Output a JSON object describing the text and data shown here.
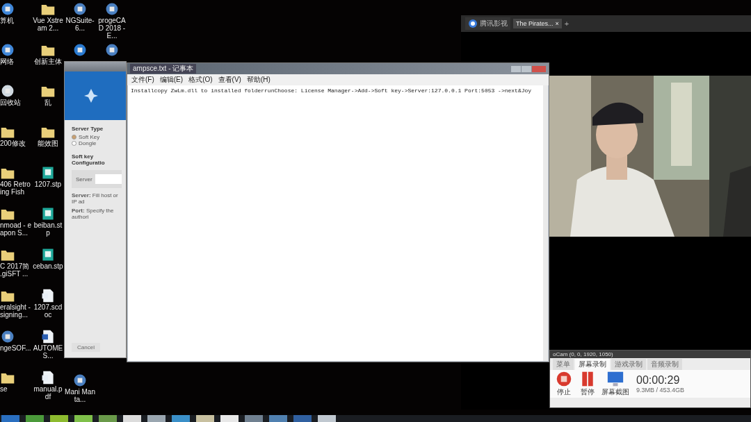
{
  "desktop_columns": [
    [
      {
        "label": "算机",
        "kind": "computer"
      },
      {
        "label": "网络",
        "kind": "network"
      },
      {
        "label": "回收站",
        "kind": "bin"
      },
      {
        "label": "200修改",
        "kind": "folder"
      },
      {
        "label": "406 Retro ing Fish",
        "kind": "folder"
      },
      {
        "label": "nmoad - eapon S...",
        "kind": "folder"
      },
      {
        "label": "C 2017简 .giSFT ...",
        "kind": "folder"
      },
      {
        "label": "eralsight - signing...",
        "kind": "folder"
      },
      {
        "label": "ngeSOF...",
        "kind": "app"
      },
      {
        "label": "se",
        "kind": "folder"
      }
    ],
    [
      {
        "label": "Vue Xstream 2...",
        "kind": "folder"
      },
      {
        "label": "创新主体",
        "kind": "folder"
      },
      {
        "label": "乱",
        "kind": "folder"
      },
      {
        "label": "能效图",
        "kind": "folder"
      },
      {
        "label": "1207.stp",
        "kind": "model"
      },
      {
        "label": "beiban.stp",
        "kind": "model"
      },
      {
        "label": "ceban.stp",
        "kind": "model"
      },
      {
        "label": "1207.scdoc",
        "kind": "doc"
      },
      {
        "label": "AUTOMES...",
        "kind": "word"
      },
      {
        "label": "manual.pdf",
        "kind": "doc"
      }
    ],
    [
      {
        "label": "NGSuite-6...",
        "kind": "app"
      },
      {
        "kind": "bird"
      },
      {
        "label": "Mani Manta...",
        "kind": "app"
      }
    ],
    [
      {
        "label": "progeCAD 2018 - E...",
        "kind": "app"
      },
      {
        "kind": "app"
      }
    ]
  ],
  "license_window": {
    "server_type_heading": "Server Type",
    "options": [
      {
        "label": "Soft Key",
        "selected": true
      },
      {
        "label": "Dongle",
        "selected": false
      }
    ],
    "config_heading": "Soft key Configuratio",
    "server_label": "Server",
    "help": [
      "**Server:** Fill host or IP ad",
      "**Port:** Specify the authori"
    ],
    "cancel": "Cancel"
  },
  "notepad": {
    "title": "ampsce.txt - 记事本",
    "menu": [
      "文件(F)",
      "编辑(E)",
      "格式(O)",
      "查看(V)",
      "帮助(H)"
    ],
    "text": "Installcopy ZwLm.dll to installed folderrunChoose: License Manager->Add->Soft key->Server:127.0.0.1 Port:5053 ->next&Joy"
  },
  "player": {
    "tabs": [
      {
        "label": "腾讯影视",
        "selected": false
      },
      {
        "label": "The Pirates...",
        "selected": true
      }
    ],
    "close": "×",
    "new_tab": "+"
  },
  "recorder": {
    "title": "oCam (0, 0, 1920, 1050)",
    "tabs": [
      {
        "label": "菜单",
        "selected": false
      },
      {
        "label": "屏幕录制",
        "selected": true
      },
      {
        "label": "游戏录制",
        "selected": false
      },
      {
        "label": "音频录制",
        "selected": false
      }
    ],
    "buttons": [
      {
        "label": "停止",
        "kind": "stop"
      },
      {
        "label": "暂停",
        "kind": "pause"
      },
      {
        "label": "屏幕截图",
        "kind": "screen"
      }
    ],
    "time": "00:00:29",
    "size": "9.3MB / 453.4GB"
  }
}
